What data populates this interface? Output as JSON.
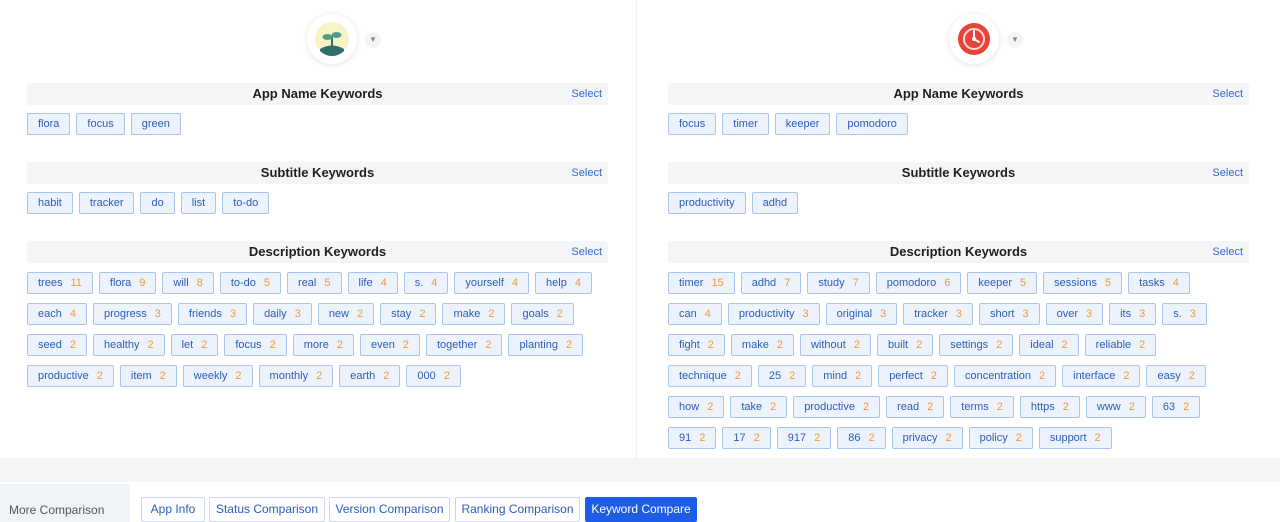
{
  "left": {
    "sections": [
      {
        "title": "App Name Keywords",
        "select": "Select",
        "tags": [
          {
            "word": "flora"
          },
          {
            "word": "focus"
          },
          {
            "word": "green"
          }
        ]
      },
      {
        "title": "Subtitle Keywords",
        "select": "Select",
        "tags": [
          {
            "word": "habit"
          },
          {
            "word": "tracker"
          },
          {
            "word": "do"
          },
          {
            "word": "list"
          },
          {
            "word": "to-do"
          }
        ]
      },
      {
        "title": "Description Keywords",
        "select": "Select",
        "tags": [
          {
            "word": "trees",
            "count": "11"
          },
          {
            "word": "flora",
            "count": "9"
          },
          {
            "word": "will",
            "count": "8"
          },
          {
            "word": "to-do",
            "count": "5"
          },
          {
            "word": "real",
            "count": "5"
          },
          {
            "word": "life",
            "count": "4"
          },
          {
            "word": "s.",
            "count": "4"
          },
          {
            "word": "yourself",
            "count": "4"
          },
          {
            "word": "help",
            "count": "4"
          },
          {
            "word": "each",
            "count": "4"
          },
          {
            "word": "progress",
            "count": "3"
          },
          {
            "word": "friends",
            "count": "3"
          },
          {
            "word": "daily",
            "count": "3"
          },
          {
            "word": "new",
            "count": "2"
          },
          {
            "word": "stay",
            "count": "2"
          },
          {
            "word": "make",
            "count": "2"
          },
          {
            "word": "goals",
            "count": "2"
          },
          {
            "word": "seed",
            "count": "2"
          },
          {
            "word": "healthy",
            "count": "2"
          },
          {
            "word": "let",
            "count": "2"
          },
          {
            "word": "focus",
            "count": "2"
          },
          {
            "word": "more",
            "count": "2"
          },
          {
            "word": "even",
            "count": "2"
          },
          {
            "word": "together",
            "count": "2"
          },
          {
            "word": "planting",
            "count": "2"
          },
          {
            "word": "productive",
            "count": "2"
          },
          {
            "word": "item",
            "count": "2"
          },
          {
            "word": "weekly",
            "count": "2"
          },
          {
            "word": "monthly",
            "count": "2"
          },
          {
            "word": "earth",
            "count": "2"
          },
          {
            "word": "000",
            "count": "2"
          }
        ]
      }
    ]
  },
  "right": {
    "sections": [
      {
        "title": "App Name Keywords",
        "select": "Select",
        "tags": [
          {
            "word": "focus"
          },
          {
            "word": "timer"
          },
          {
            "word": "keeper"
          },
          {
            "word": "pomodoro"
          }
        ]
      },
      {
        "title": "Subtitle Keywords",
        "select": "Select",
        "tags": [
          {
            "word": "productivity"
          },
          {
            "word": "adhd"
          }
        ]
      },
      {
        "title": "Description Keywords",
        "select": "Select",
        "tags": [
          {
            "word": "timer",
            "count": "15"
          },
          {
            "word": "adhd",
            "count": "7"
          },
          {
            "word": "study",
            "count": "7"
          },
          {
            "word": "pomodoro",
            "count": "6"
          },
          {
            "word": "keeper",
            "count": "5"
          },
          {
            "word": "sessions",
            "count": "5"
          },
          {
            "word": "tasks",
            "count": "4"
          },
          {
            "word": "can",
            "count": "4"
          },
          {
            "word": "productivity",
            "count": "3"
          },
          {
            "word": "original",
            "count": "3"
          },
          {
            "word": "tracker",
            "count": "3"
          },
          {
            "word": "short",
            "count": "3"
          },
          {
            "word": "over",
            "count": "3"
          },
          {
            "word": "its",
            "count": "3"
          },
          {
            "word": "s.",
            "count": "3"
          },
          {
            "word": "fight",
            "count": "2"
          },
          {
            "word": "make",
            "count": "2"
          },
          {
            "word": "without",
            "count": "2"
          },
          {
            "word": "built",
            "count": "2"
          },
          {
            "word": "settings",
            "count": "2"
          },
          {
            "word": "ideal",
            "count": "2"
          },
          {
            "word": "reliable",
            "count": "2"
          },
          {
            "word": "technique",
            "count": "2"
          },
          {
            "word": "25",
            "count": "2"
          },
          {
            "word": "mind",
            "count": "2"
          },
          {
            "word": "perfect",
            "count": "2"
          },
          {
            "word": "concentration",
            "count": "2"
          },
          {
            "word": "interface",
            "count": "2"
          },
          {
            "word": "easy",
            "count": "2"
          },
          {
            "word": "how",
            "count": "2"
          },
          {
            "word": "take",
            "count": "2"
          },
          {
            "word": "productive",
            "count": "2"
          },
          {
            "word": "read",
            "count": "2"
          },
          {
            "word": "terms",
            "count": "2"
          },
          {
            "word": "https",
            "count": "2"
          },
          {
            "word": "www",
            "count": "2"
          },
          {
            "word": "63",
            "count": "2"
          },
          {
            "word": "91",
            "count": "2"
          },
          {
            "word": "17",
            "count": "2"
          },
          {
            "word": "917",
            "count": "2"
          },
          {
            "word": "86",
            "count": "2"
          },
          {
            "word": "privacy",
            "count": "2"
          },
          {
            "word": "policy",
            "count": "2"
          },
          {
            "word": "support",
            "count": "2"
          }
        ]
      }
    ]
  },
  "icons": {
    "left_app": "flora-plant-icon",
    "right_app": "tomato-timer-icon",
    "dropdown": "chevron-down-icon"
  },
  "colors": {
    "accent": "#1d5ce6",
    "tag_bg": "#edf3fd",
    "tag_border": "#a9c4ee",
    "count": "#f29a2e"
  },
  "footer": {
    "label": "More Comparison",
    "tabs": [
      {
        "label": "App Info"
      },
      {
        "label": "Status Comparison"
      },
      {
        "label": "Version Comparison"
      },
      {
        "label": "Ranking Comparison"
      },
      {
        "label": "Keyword Compare",
        "active": true
      }
    ]
  }
}
